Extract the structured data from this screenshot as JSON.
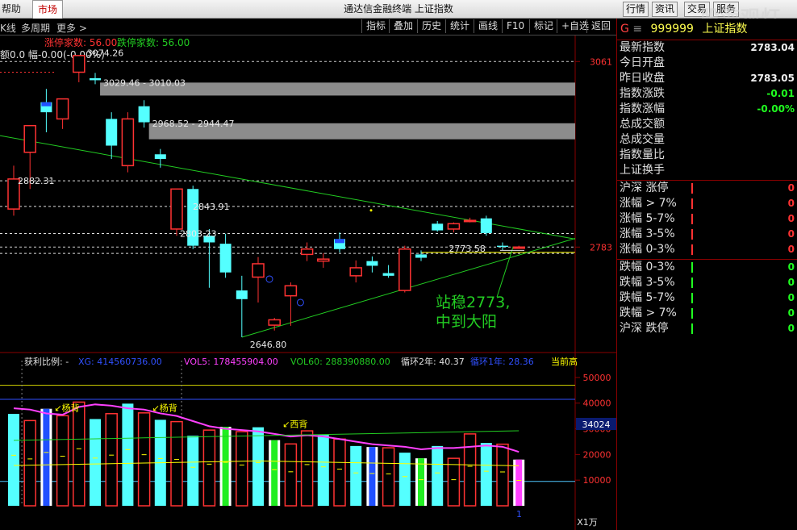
{
  "topbar": {
    "left_tab": "帮助",
    "active_tab": "市场",
    "title": "通达信金融终端  上证指数",
    "buttons": [
      "行情",
      "资讯",
      "交易",
      "服务"
    ],
    "watermark": "股海观灯"
  },
  "toolbar": {
    "left_items": [
      "K线",
      "多周期",
      "更多 >"
    ],
    "right_buttons": [
      "指标",
      "叠加",
      "历史",
      "统计",
      "画线",
      "F10",
      "标记",
      "+自选",
      "返回"
    ]
  },
  "chart_data": [
    {
      "type": "candlestick",
      "header_limit_up": "涨停家数: 56.00",
      "header_limit_down": "跌停家数: 56.00",
      "header_left": "额0.0 幅-0.00(-0.00%)",
      "y_ticks": [
        3061,
        2783
      ],
      "ylim": [
        2625,
        3100
      ],
      "candles": [
        {
          "o": 2840,
          "h": 2905,
          "l": 2830,
          "c": 2885
        },
        {
          "o": 2925,
          "h": 2960,
          "l": 2870,
          "c": 2965
        },
        {
          "o": 3000,
          "h": 3020,
          "l": 2955,
          "c": 2985
        },
        {
          "o": 2975,
          "h": 3005,
          "l": 2960,
          "c": 3005
        },
        {
          "o": 3045,
          "h": 3070,
          "l": 3030,
          "c": 3070
        },
        {
          "o": 3036,
          "h": 3044,
          "l": 3027,
          "c": 3033
        },
        {
          "o": 2975,
          "h": 2985,
          "l": 2915,
          "c": 2935
        },
        {
          "o": 2905,
          "h": 2985,
          "l": 2895,
          "c": 2975
        },
        {
          "o": 2994,
          "h": 3003,
          "l": 2962,
          "c": 2970
        },
        {
          "o": 2922,
          "h": 2930,
          "l": 2902,
          "c": 2915
        },
        {
          "o": 2810,
          "h": 2865,
          "l": 2800,
          "c": 2870
        },
        {
          "o": 2870,
          "h": 2875,
          "l": 2780,
          "c": 2785
        },
        {
          "o": 2800,
          "h": 2810,
          "l": 2722,
          "c": 2790
        },
        {
          "o": 2788,
          "h": 2803,
          "l": 2737,
          "c": 2745
        },
        {
          "o": 2718,
          "h": 2740,
          "l": 2648,
          "c": 2705
        },
        {
          "o": 2738,
          "h": 2768,
          "l": 2700,
          "c": 2758
        },
        {
          "o": 2666,
          "h": 2677,
          "l": 2658,
          "c": 2674
        },
        {
          "o": 2710,
          "h": 2730,
          "l": 2665,
          "c": 2725
        },
        {
          "o": 2772,
          "h": 2790,
          "l": 2762,
          "c": 2780
        },
        {
          "o": 2762,
          "h": 2774,
          "l": 2752,
          "c": 2765
        },
        {
          "o": 2795,
          "h": 2805,
          "l": 2775,
          "c": 2780
        },
        {
          "o": 2740,
          "h": 2763,
          "l": 2730,
          "c": 2752
        },
        {
          "o": 2762,
          "h": 2769,
          "l": 2745,
          "c": 2755
        },
        {
          "o": 2744,
          "h": 2756,
          "l": 2737,
          "c": 2740
        },
        {
          "o": 2718,
          "h": 2785,
          "l": 2715,
          "c": 2780
        },
        {
          "o": 2772,
          "h": 2778,
          "l": 2762,
          "c": 2767
        },
        {
          "o": 2818,
          "h": 2822,
          "l": 2806,
          "c": 2808
        },
        {
          "o": 2810,
          "h": 2820,
          "l": 2805,
          "c": 2818
        },
        {
          "o": 2822,
          "h": 2827,
          "l": 2820,
          "c": 2823
        },
        {
          "o": 2826,
          "h": 2830,
          "l": 2800,
          "c": 2804
        },
        {
          "o": 2785,
          "h": 2790,
          "l": 2778,
          "c": 2784
        },
        {
          "o": 2783,
          "h": 2785,
          "l": 2781,
          "c": 2783
        }
      ],
      "gray_bands": [
        [
          3029.46,
          3010.03
        ],
        [
          2968.52,
          2944.47
        ]
      ],
      "dashed_levels": [
        3061,
        2882.31,
        2843.91,
        2803.23,
        2783,
        2773.58
      ],
      "labels": [
        {
          "text": "3074.26",
          "i": 4,
          "v": 3074.26
        },
        {
          "text": "3029.46 - 3010.03",
          "i": 5,
          "v": 3029.46
        },
        {
          "text": "2968.52 - 2944.47",
          "i": 8,
          "v": 2968.52
        },
        {
          "text": "2882.31",
          "i": 0,
          "v": 2882.31
        },
        {
          "text": "2843.91",
          "i": 10,
          "v": 2843.91
        },
        {
          "text": "2803.23",
          "i": 10,
          "v": 2803.23
        },
        {
          "text": "2773.58",
          "i": 27,
          "v": 2773.58
        },
        {
          "text": "2646.80",
          "i": 14,
          "v": 2646.8
        }
      ],
      "annotation": "站稳2773,\n中到大阳"
    },
    {
      "type": "bar",
      "header": {
        "profit_ratio": "获利比例: -",
        "xg": "XG: 414560736.00",
        "vol5": "VOL5: 178455904.00",
        "vol60": "VOL60: 288390880.00",
        "cycle2": "循环2年: 40.37",
        "cycle1": "循环1年: 28.36",
        "current": "当前高"
      },
      "y_ticks": [
        50000,
        40000,
        30000,
        20000,
        10000
      ],
      "unit": "X1万",
      "current_value": "34024",
      "ylim": [
        0,
        55000
      ],
      "values": [
        35800,
        33200,
        37800,
        35100,
        40400,
        33800,
        35900,
        39800,
        36200,
        33500,
        32800,
        27300,
        29500,
        30800,
        28900,
        30600,
        25600,
        24100,
        29200,
        27600,
        26000,
        23300,
        22900,
        22600,
        20700,
        18500,
        23300,
        18500,
        28000,
        24500,
        24000,
        18000
      ],
      "bar_types": [
        "cyan",
        "hollow",
        "blue",
        "hollow",
        "hollow",
        "cyan",
        "hollow",
        "cyan",
        "hollow",
        "cyan",
        "hollow",
        "cyan",
        "hollow",
        "green",
        "hollow",
        "cyan",
        "green",
        "hollow",
        "hollow",
        "cyan",
        "hollow",
        "cyan",
        "blue",
        "hollow",
        "cyan",
        "green",
        "cyan",
        "hollow",
        "hollow",
        "cyan",
        "hollow",
        "magenta"
      ],
      "ma5": [
        38000,
        37500,
        36000,
        35500,
        38500,
        39500,
        39000,
        38000,
        37500,
        36000,
        35000,
        33000,
        31000,
        30000,
        29500,
        29000,
        28000,
        27000,
        27500,
        27000,
        26000,
        25000,
        24000,
        23500,
        23000,
        22000,
        22500,
        22500,
        23000,
        23500,
        23000,
        21000
      ],
      "hlines": [
        47000,
        41500,
        9500
      ],
      "labels": [
        {
          "text": "杨背",
          "i": 2
        },
        {
          "text": "杨背",
          "i": 8
        },
        {
          "text": "西背",
          "i": 16
        }
      ]
    }
  ],
  "quote": {
    "marker": "G",
    "code": "999999",
    "name": "上证指数",
    "rows": [
      {
        "k": "最新指数",
        "v": "2783.04",
        "color": "#f0f0f0"
      },
      {
        "k": "今日开盘",
        "v": "",
        "color": "#f0f0f0"
      },
      {
        "k": "昨日收盘",
        "v": "2783.05",
        "color": "#f0f0f0"
      },
      {
        "k": "指数涨跌",
        "v": "-0.01",
        "color": "#20ff20"
      },
      {
        "k": "指数涨幅",
        "v": "-0.00%",
        "color": "#20ff20"
      },
      {
        "k": "总成交额",
        "v": "",
        "color": "#f0f0f0"
      },
      {
        "k": "总成交量",
        "v": "",
        "color": "#f0f0f0"
      },
      {
        "k": "指数量比",
        "v": "",
        "color": "#f0f0f0"
      },
      {
        "k": "上证换手",
        "v": "",
        "color": "#f0f0f0"
      }
    ],
    "up_rows": [
      {
        "k": "沪深 涨停",
        "v": "0"
      },
      {
        "k": "涨幅 > 7%",
        "v": "0"
      },
      {
        "k": "涨幅 5-7%",
        "v": "0"
      },
      {
        "k": "涨幅 3-5%",
        "v": "0"
      },
      {
        "k": "涨幅 0-3%",
        "v": "0"
      }
    ],
    "down_rows": [
      {
        "k": "跌幅 0-3%",
        "v": "0"
      },
      {
        "k": "跌幅 3-5%",
        "v": "0"
      },
      {
        "k": "跌幅 5-7%",
        "v": "0"
      },
      {
        "k": "跌幅 > 7%",
        "v": "0"
      },
      {
        "k": "沪深 跌停",
        "v": "0"
      }
    ]
  },
  "colors": {
    "up": "#ff3232",
    "down": "#54ffff",
    "line_green": "#22cc22",
    "yellow": "#ffff00",
    "magenta": "#ff40ff",
    "blue": "#2050ff"
  }
}
